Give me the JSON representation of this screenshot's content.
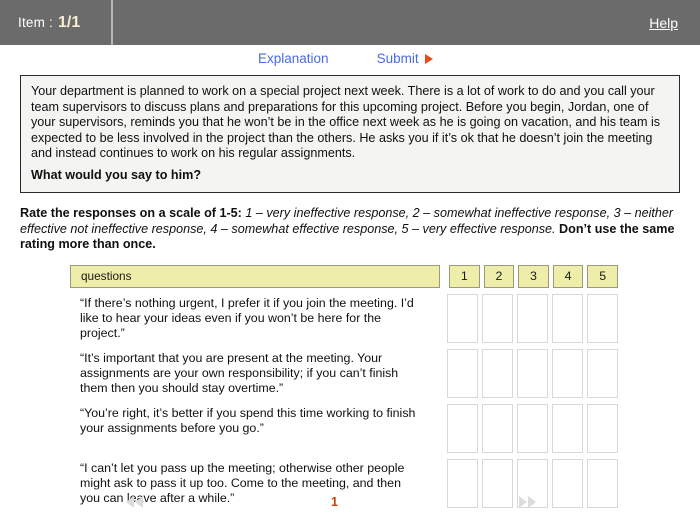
{
  "header": {
    "item_label": "Item :",
    "item_value": "1/1",
    "help_label": "Help"
  },
  "toolbar": {
    "explanation_label": "Explanation",
    "submit_label": "Submit",
    "submit_arrow_icon": "play-triangle-icon"
  },
  "scenario": {
    "body": "Your department is planned to work on a special project next week. There is a lot of work to do and you call your team supervisors to discuss plans and preparations for this upcoming project. Before you begin, Jordan, one of your supervisors, reminds you that he won’t be in the office next week as he is going on vacation, and his team is expected to be less involved in the project than the others. He asks you if it’s ok that he doesn’t join the meeting and instead continues to work on his regular assignments.",
    "question": "What would you say to him?"
  },
  "instructions": {
    "lead": "Rate the responses on a scale of 1-5:",
    "scale_description": " 1 – very ineffective response, 2 – somewhat ineffective response, 3 – neither effective not ineffective response, 4 – somewhat effective response, 5 – very effective response. ",
    "constraint": "Don’t use the same rating more than once."
  },
  "table": {
    "questions_header": "questions",
    "rating_columns": [
      "1",
      "2",
      "3",
      "4",
      "5"
    ],
    "rows": [
      {
        "text": "“If there’s nothing urgent, I prefer it if you join the meeting. I’d like to hear your ideas even if you won’t be here for the project.”",
        "selected": null
      },
      {
        "text": "“It’s important that you are present at the meeting. Your assignments are your own responsibility; if you can’t finish them then you should stay overtime.”",
        "selected": null
      },
      {
        "text": "“You’re right, it’s better if you spend this time working to finish your assignments before you go.”",
        "selected": null
      },
      {
        "text": "“I can’t let you pass up the meeting; otherwise other people might ask to pass it up too. Come to the meeting, and then you can leave after a while.”",
        "selected": null
      }
    ]
  },
  "footer": {
    "prev_icon": "double-chevron-left-icon",
    "next_icon": "double-chevron-right-icon",
    "page_number": "1"
  },
  "colors": {
    "header_bg": "#6b6b6b",
    "link_blue": "#4a6ae8",
    "submit_arrow": "#e8491d",
    "table_header_yellow": "#eeeeaa",
    "page_number": "#c2410c"
  }
}
